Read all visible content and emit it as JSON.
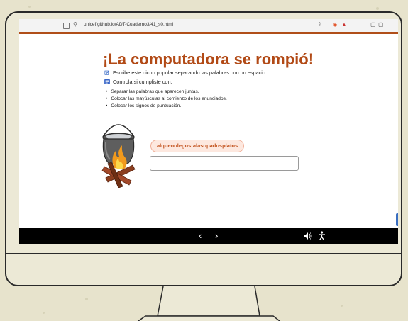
{
  "browser": {
    "url": "unicef.github.io/ADT-Cuaderno3/41_s0.html"
  },
  "lesson": {
    "title": "¡La computadora se rompió!",
    "instruction": "Escribe este dicho popular separando las palabras con un espacio.",
    "check_label": "Controla si cumpliste con:",
    "criteria": [
      "Separar las palabras que aparecen juntas.",
      "Colocar las mayúsculas al comienzo de los enunciados.",
      "Colocar los signos de puntuación."
    ],
    "phrase": "alquenolegustalasopadosplatos",
    "answer_value": ""
  },
  "nav": {
    "prev_glyph": "‹",
    "next_glyph": "›"
  },
  "colors": {
    "accent": "#b04e19",
    "title": "#b24a16",
    "chip_bg": "#fde8df",
    "chip_text": "#c2521d"
  },
  "icons": [
    "edit-icon",
    "checklist-icon",
    "sound-icon",
    "accessibility-icon",
    "tab-icon",
    "lock-icon"
  ]
}
